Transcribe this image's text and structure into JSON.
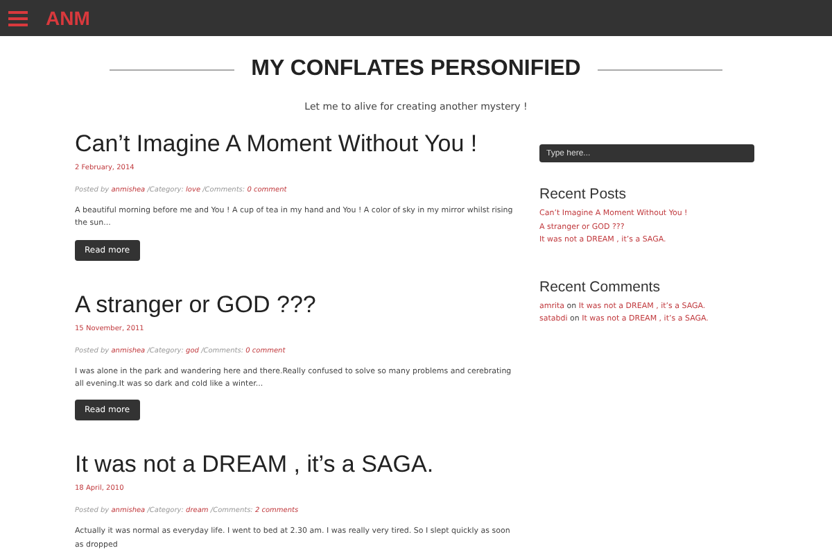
{
  "header": {
    "logo": "ANM"
  },
  "site": {
    "title": "MY CONFLATES PERSONIFIED",
    "tagline": "Let me to alive for creating another mystery !"
  },
  "posts": [
    {
      "title": "Can’t Imagine A Moment Without You !",
      "date": "2 February, 2014",
      "meta": [
        {
          "kind": "label",
          "text": "Posted by"
        },
        {
          "kind": "link",
          "text": "anmishea"
        },
        {
          "kind": "label",
          "text": "/Category:"
        },
        {
          "kind": "link",
          "text": "love"
        },
        {
          "kind": "label",
          "text": "/Comments:"
        },
        {
          "kind": "link",
          "text": "0 comment"
        }
      ],
      "excerpt": "A beautiful morning before me and You ! A cup of tea in my hand and You ! A color of sky in my mirror whilst rising the sun...",
      "button": "Read more"
    },
    {
      "title": "A stranger or GOD ???",
      "date": "15 November, 2011",
      "meta": [
        {
          "kind": "label",
          "text": "Posted by"
        },
        {
          "kind": "link",
          "text": "anmishea"
        },
        {
          "kind": "label",
          "text": "/Category:"
        },
        {
          "kind": "link",
          "text": "god"
        },
        {
          "kind": "label",
          "text": "/Comments:"
        },
        {
          "kind": "link",
          "text": "0 comment"
        }
      ],
      "excerpt": "I was alone in the park and wandering here and there.Really confused to solve so many problems and cerebrating all evening.It was so dark and cold like a winter...",
      "button": "Read more"
    },
    {
      "title": "It was not a DREAM , it’s a SAGA.",
      "date": "18 April, 2010",
      "meta": [
        {
          "kind": "label",
          "text": "Posted by"
        },
        {
          "kind": "link",
          "text": "anmishea"
        },
        {
          "kind": "label",
          "text": "/Category:"
        },
        {
          "kind": "link",
          "text": "dream"
        },
        {
          "kind": "label",
          "text": "/Comments:"
        },
        {
          "kind": "link",
          "text": "2 comments"
        }
      ],
      "excerpt": "Actually it was normal as everyday life. I went to bed at 2.30 am. I was really very tired. So I slept quickly as soon as dropped"
    }
  ],
  "sidebar": {
    "search": {
      "placeholder": "Type here..."
    },
    "recent_posts": {
      "heading": "Recent Posts",
      "items": [
        "Can’t Imagine A Moment Without You !",
        "A stranger or GOD ???",
        "It was not a DREAM , it’s a SAGA."
      ]
    },
    "recent_comments": {
      "heading": "Recent Comments",
      "items": [
        {
          "author": "amrita",
          "joiner": "on",
          "post": "It was not a DREAM , it’s a SAGA."
        },
        {
          "author": "satabdi",
          "joiner": "on",
          "post": "It was not a DREAM , it’s a SAGA."
        }
      ]
    }
  }
}
